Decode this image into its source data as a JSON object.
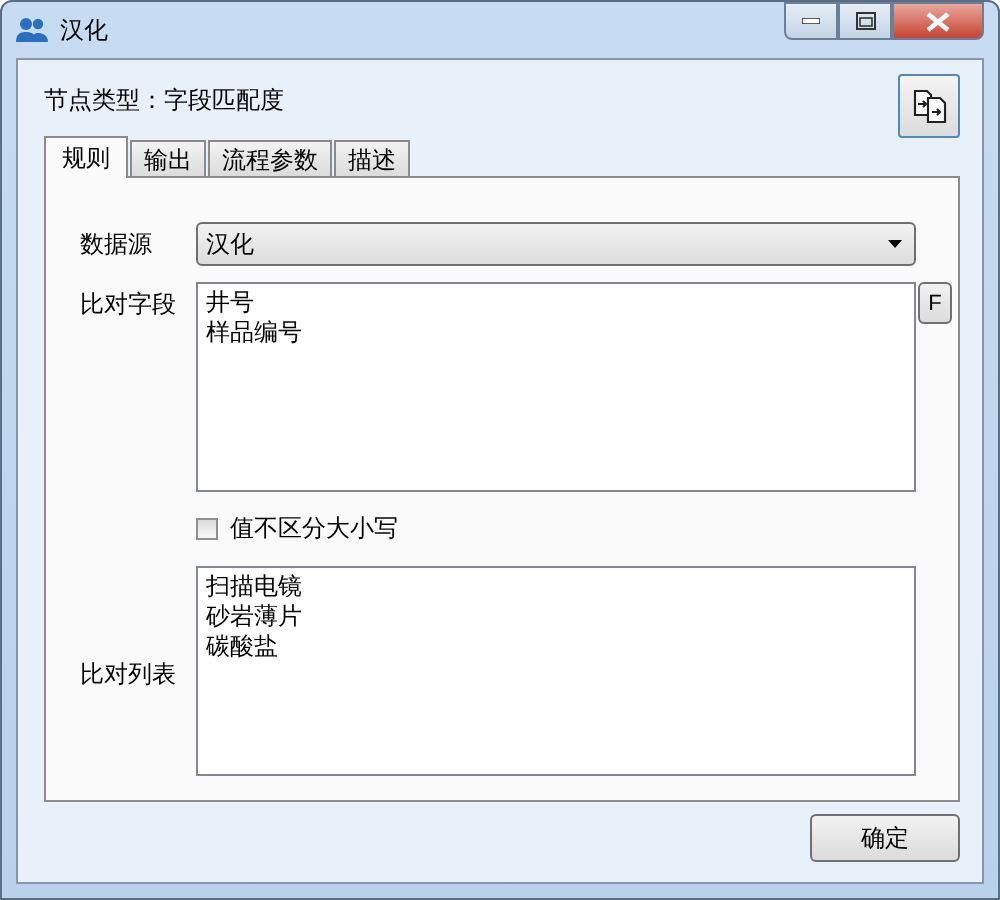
{
  "window": {
    "title": "汉化"
  },
  "node_type": "节点类型：字段匹配度",
  "tabs": [
    {
      "label": "规则",
      "selected": true
    },
    {
      "label": "输出",
      "selected": false
    },
    {
      "label": "流程参数",
      "selected": false
    },
    {
      "label": "描述",
      "selected": false
    }
  ],
  "data_source": {
    "label": "数据源",
    "value": "汉化"
  },
  "compare_fields": {
    "label": "比对字段",
    "lines": [
      "井号",
      "样品编号"
    ],
    "button": "F"
  },
  "case_insensitive": {
    "label": "值不区分大小写",
    "checked": false
  },
  "compare_list": {
    "label": "比对列表",
    "lines": [
      "扫描电镜",
      "砂岩薄片",
      "碳酸盐"
    ]
  },
  "buttons": [
    "确定"
  ]
}
